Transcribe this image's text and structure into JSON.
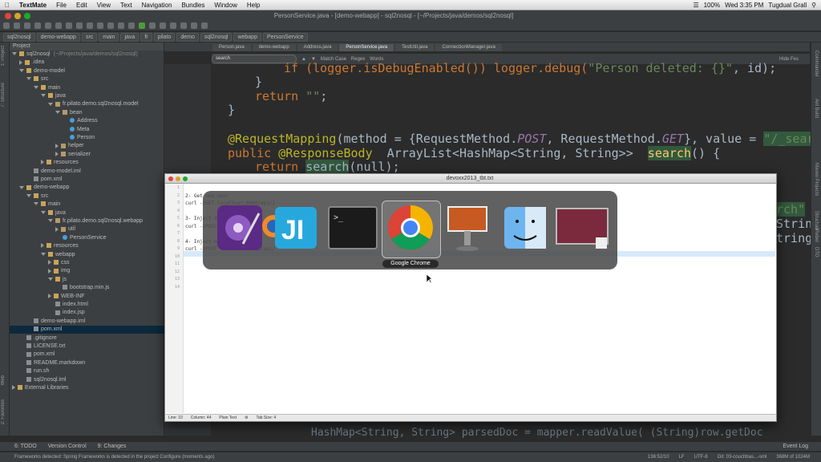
{
  "menubar": {
    "items": [
      "TextMate",
      "File",
      "Edit",
      "View",
      "Text",
      "Navigation",
      "Bundles",
      "Window",
      "Help"
    ],
    "battery": "100%",
    "clock": "Wed 3:35 PM",
    "user": "Tugdual Grall"
  },
  "window": {
    "title": "PersonService.java - [demo-webapp] - sql2nosql - [~/Projects/java/demos/sql2nosql]"
  },
  "breadcrumbs": [
    "sql2nosql",
    "demo-webapp",
    "src",
    "main",
    "java",
    "fr",
    "pilato",
    "demo",
    "sql2nosql",
    "webapp",
    "PersonService"
  ],
  "project": {
    "header": "Project",
    "tree": [
      {
        "label": "sql2nosql",
        "path": "(~/Projects/java/demos/sql2nosql)",
        "depth": 0,
        "kind": "folder",
        "open": true
      },
      {
        "label": ".idea",
        "depth": 1,
        "kind": "folder",
        "open": false
      },
      {
        "label": "demo-model",
        "depth": 1,
        "kind": "folder",
        "open": true
      },
      {
        "label": "src",
        "depth": 2,
        "kind": "folder",
        "open": true
      },
      {
        "label": "main",
        "depth": 3,
        "kind": "folder",
        "open": true
      },
      {
        "label": "java",
        "depth": 4,
        "kind": "folder",
        "open": true
      },
      {
        "label": "fr.pilato.demo.sql2nosql.model",
        "depth": 5,
        "kind": "package",
        "open": true
      },
      {
        "label": "bean",
        "depth": 6,
        "kind": "package",
        "open": true
      },
      {
        "label": "Address",
        "depth": 7,
        "kind": "class"
      },
      {
        "label": "Meta",
        "depth": 7,
        "kind": "class"
      },
      {
        "label": "Person",
        "depth": 7,
        "kind": "class"
      },
      {
        "label": "helper",
        "depth": 6,
        "kind": "package",
        "open": false
      },
      {
        "label": "serializer",
        "depth": 6,
        "kind": "package",
        "open": false
      },
      {
        "label": "resources",
        "depth": 4,
        "kind": "folder",
        "open": false
      },
      {
        "label": "demo-model.iml",
        "depth": 2,
        "kind": "file"
      },
      {
        "label": "pom.xml",
        "depth": 2,
        "kind": "file"
      },
      {
        "label": "demo-webapp",
        "depth": 1,
        "kind": "folder",
        "open": true
      },
      {
        "label": "src",
        "depth": 2,
        "kind": "folder",
        "open": true
      },
      {
        "label": "main",
        "depth": 3,
        "kind": "folder",
        "open": true
      },
      {
        "label": "java",
        "depth": 4,
        "kind": "folder",
        "open": true
      },
      {
        "label": "fr.pilato.demo.sql2nosql.webapp",
        "depth": 5,
        "kind": "package",
        "open": true
      },
      {
        "label": "util",
        "depth": 6,
        "kind": "package",
        "open": false
      },
      {
        "label": "PersonService",
        "depth": 6,
        "kind": "class"
      },
      {
        "label": "resources",
        "depth": 4,
        "kind": "folder",
        "open": false
      },
      {
        "label": "webapp",
        "depth": 4,
        "kind": "folder",
        "open": true
      },
      {
        "label": "css",
        "depth": 5,
        "kind": "folder",
        "open": false
      },
      {
        "label": "img",
        "depth": 5,
        "kind": "folder",
        "open": false
      },
      {
        "label": "js",
        "depth": 5,
        "kind": "folder",
        "open": true
      },
      {
        "label": "bootstrap.min.js",
        "depth": 6,
        "kind": "file"
      },
      {
        "label": "WEB-INF",
        "depth": 5,
        "kind": "folder",
        "open": false
      },
      {
        "label": "index.html",
        "depth": 5,
        "kind": "file"
      },
      {
        "label": "index.jsp",
        "depth": 5,
        "kind": "file"
      },
      {
        "label": "demo-webapp.iml",
        "depth": 2,
        "kind": "file"
      },
      {
        "label": "pom.xml",
        "depth": 2,
        "kind": "file",
        "selected": true
      },
      {
        "label": ".gitignore",
        "depth": 1,
        "kind": "file"
      },
      {
        "label": "LICENSE.txt",
        "depth": 1,
        "kind": "file"
      },
      {
        "label": "pom.xml",
        "depth": 1,
        "kind": "file"
      },
      {
        "label": "README.markdown",
        "depth": 1,
        "kind": "file"
      },
      {
        "label": "run.sh",
        "depth": 1,
        "kind": "file"
      },
      {
        "label": "sql2nosql.iml",
        "depth": 1,
        "kind": "file"
      },
      {
        "label": "External Libraries",
        "depth": 0,
        "kind": "folder",
        "open": false
      }
    ]
  },
  "tabs": [
    "Person.java",
    "demo-webapp",
    "Address.java",
    "PersonService.java",
    "TestUtil.java",
    "ConnectionManager.java"
  ],
  "active_tab": 3,
  "search": {
    "placeholder": "search",
    "options": [
      "Match Case",
      "Regex",
      "Words"
    ],
    "hide": "Hide Fes"
  },
  "code": {
    "line1a": "if (logger.isDebugEnabled()) logger.debug(",
    "line1b": "\"Person deleted: {}\"",
    "line1c": ", id);",
    "line2": "}",
    "line3a": "return ",
    "line3b": "\"\"",
    "line3c": ";",
    "line4": "}",
    "line5a": "@RequestMapping",
    "line5b": "(method = {RequestMethod.",
    "line5c": "POST",
    "line5d": ", RequestMethod.",
    "line5e": "GET",
    "line5f": "}, value = ",
    "line5g": "\"/_search\"",
    "line6a": "public ",
    "line6b": "@ResponseBody",
    "line6c": "  ArrayList<HashMap<String, String>>  ",
    "line6d": "search",
    "line6e": "() {",
    "line7a": "return ",
    "line7b": "search",
    "line7c": "(null);",
    "line8": "HashMap<String, String> parsedDoc = mapper.readValue( (String)row.getDoc",
    "rframe1": "rch\"",
    "rframe2": "Strin",
    "rframe3": "tring"
  },
  "textmate": {
    "title": "devoxx2013_tbt.txt",
    "lines": [
      "",
      "2- Get one user",
      "curl -XGET localhost:8080/api/1",
      "",
      "3- Inject data",
      "curl -XPOST localhost:8080/api/",
      "",
      "4- Inject more",
      "curl -XPOST localhost:8080/api/",
      "",
      "",
      "",
      "",
      ""
    ],
    "status": {
      "line": "Line: 10",
      "column": "Column: 44",
      "mode": "Plain Text",
      "tab": "Tab Size: 4"
    }
  },
  "switcher": {
    "apps": [
      "Eclipse",
      "Firefox",
      "IntelliJ IDEA",
      "Terminal",
      "Google Chrome",
      "Keynote",
      "Finder",
      "Screen Sharing"
    ],
    "selected_label": "Google Chrome"
  },
  "bottom_tools": [
    "6: TODO",
    "Version Control",
    "9: Changes",
    "Event Log"
  ],
  "statusbar": {
    "message": "Frameworks detected: Spring Frameworks is detected in the project Configure (moments ago)",
    "position": "136:52/10",
    "line_sep": "LF",
    "encoding": "UTF-8",
    "git": "Git: 03-couchbas...-sml",
    "memory": "368M of 1024M"
  },
  "right_strip": [
    "Commander",
    "Ant Build",
    "Maven Projects",
    "Structure",
    "JRebel",
    "DTO"
  ],
  "left_strip": [
    "1: Project",
    "7: Structure",
    "Web",
    "2: Favorites"
  ],
  "colors": {
    "accent": "#0d293e",
    "search_hl": "#32593d",
    "keyword": "#cc7832",
    "string": "#6a8759"
  }
}
